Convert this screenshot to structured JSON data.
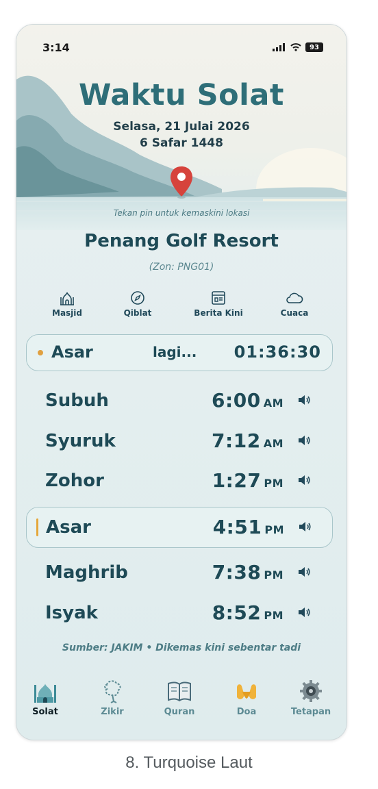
{
  "status": {
    "time": "3:14",
    "battery": "93"
  },
  "header": {
    "title": "Waktu Solat",
    "date_gregorian": "Selasa, 21 Julai 2026",
    "date_hijri": "6 Safar 1448",
    "pin_hint": "Tekan pin untuk kemaskini lokasi",
    "location": "Penang Golf Resort",
    "zone": "(Zon: PNG01)"
  },
  "quick_actions": [
    {
      "label": "Masjid",
      "icon": "mosque-icon"
    },
    {
      "label": "Qiblat",
      "icon": "compass-icon"
    },
    {
      "label": "Berita Kini",
      "icon": "news-icon"
    },
    {
      "label": "Cuaca",
      "icon": "cloud-icon"
    }
  ],
  "next_prayer": {
    "name": "Asar",
    "text": "lagi...",
    "countdown": "01:36:30"
  },
  "prayers": [
    {
      "name": "Subuh",
      "time": "6:00",
      "ampm": "AM",
      "active": false
    },
    {
      "name": "Syuruk",
      "time": "7:12",
      "ampm": "AM",
      "active": false
    },
    {
      "name": "Zohor",
      "time": "1:27",
      "ampm": "PM",
      "active": false
    },
    {
      "name": "Asar",
      "time": "4:51",
      "ampm": "PM",
      "active": true
    },
    {
      "name": "Maghrib",
      "time": "7:38",
      "ampm": "PM",
      "active": false
    },
    {
      "name": "Isyak",
      "time": "8:52",
      "ampm": "PM",
      "active": false
    }
  ],
  "source": "Sumber: JAKIM • Dikemas kini sebentar tadi",
  "tabs": [
    {
      "label": "Solat",
      "icon": "mosque-icon",
      "active": true
    },
    {
      "label": "Zikir",
      "icon": "prayer-beads-icon",
      "active": false
    },
    {
      "label": "Quran",
      "icon": "book-icon",
      "active": false
    },
    {
      "label": "Doa",
      "icon": "praying-hands-icon",
      "active": false
    },
    {
      "label": "Tetapan",
      "icon": "gear-icon",
      "active": false
    }
  ],
  "caption": "8. Turquoise Laut",
  "colors": {
    "accent": "#2e6e78",
    "text_dark": "#1e4a56",
    "highlight": "#e5a73a",
    "pin": "#d6433c"
  }
}
